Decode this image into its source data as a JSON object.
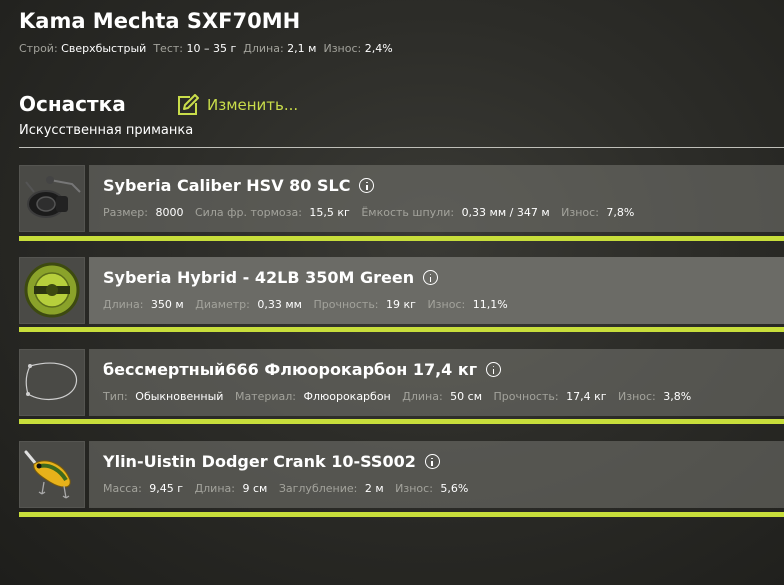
{
  "rod": {
    "title": "Kama Mechta SXF70MH",
    "stats": [
      {
        "label": "Строй:",
        "value": "Сверхбыстрый"
      },
      {
        "label": "Тест:",
        "value": "10 – 35 г"
      },
      {
        "label": "Длина:",
        "value": "2,1 м"
      },
      {
        "label": "Износ:",
        "value": "2,4%"
      }
    ]
  },
  "section": {
    "title": "Оснастка",
    "edit_label": "Изменить...",
    "subtitle": "Искусственная приманка"
  },
  "colors": {
    "accent": "#c8de3b",
    "label": "#a3a39c"
  },
  "slots": [
    {
      "icon": "reel-icon",
      "name": "Syberia Caliber HSV 80 SLC",
      "stats": [
        {
          "label": "Размер:",
          "value": "8000"
        },
        {
          "label": "Сила фр. тормоза:",
          "value": "15,5 кг"
        },
        {
          "label": "Ёмкость шпули:",
          "value": "0,33 мм / 347 м"
        },
        {
          "label": "Износ:",
          "value": "7,8%"
        }
      ]
    },
    {
      "icon": "line-spool-icon",
      "name": "Syberia Hybrid - 42LB 350M Green",
      "stats": [
        {
          "label": "Длина:",
          "value": "350 м"
        },
        {
          "label": "Диаметр:",
          "value": "0,33 мм"
        },
        {
          "label": "Прочность:",
          "value": "19 кг"
        },
        {
          "label": "Износ:",
          "value": "11,1%"
        }
      ]
    },
    {
      "icon": "leader-icon",
      "name": "бессмертный666 Флюорокарбон 17,4 кг",
      "stats": [
        {
          "label": "Тип:",
          "value": "Обыкновенный"
        },
        {
          "label": "Материал:",
          "value": "Флюорокарбон"
        },
        {
          "label": "Длина:",
          "value": "50 см"
        },
        {
          "label": "Прочность:",
          "value": "17,4 кг"
        },
        {
          "label": "Износ:",
          "value": "3,8%"
        }
      ]
    },
    {
      "icon": "crankbait-lure-icon",
      "name": "Ylin-Uistin Dodger Crank 10-SS002",
      "stats": [
        {
          "label": "Масса:",
          "value": "9,45 г"
        },
        {
          "label": "Длина:",
          "value": "9 см"
        },
        {
          "label": "Заглубление:",
          "value": "2 м"
        },
        {
          "label": "Износ:",
          "value": "5,6%"
        }
      ]
    }
  ]
}
